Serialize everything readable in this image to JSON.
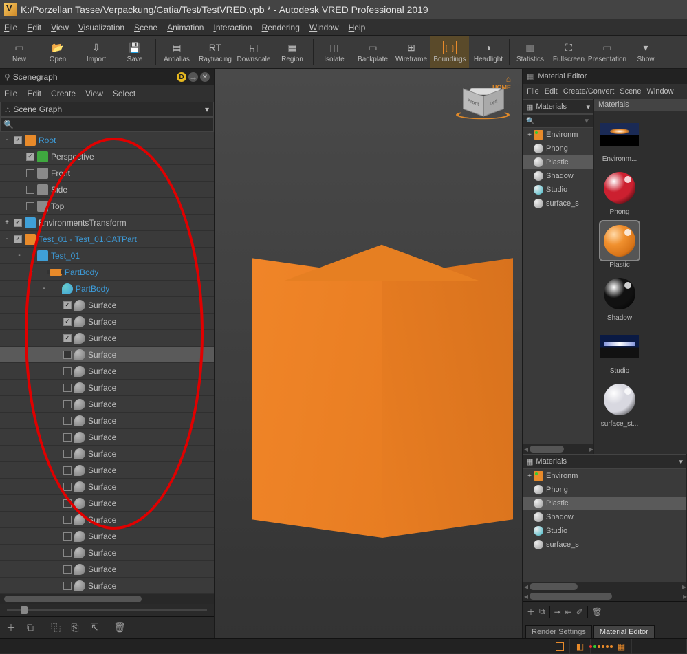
{
  "title": "K:/Porzellan Tasse/Verpackung/Catia/Test/TestVRED.vpb * - Autodesk VRED Professional 2019",
  "menu": [
    "File",
    "Edit",
    "View",
    "Visualization",
    "Scene",
    "Animation",
    "Interaction",
    "Rendering",
    "Window",
    "Help"
  ],
  "toolbar": [
    {
      "label": "New"
    },
    {
      "label": "Open"
    },
    {
      "label": "Import"
    },
    {
      "label": "Save"
    },
    {
      "label": "Antialias"
    },
    {
      "label": "Raytracing"
    },
    {
      "label": "Downscale"
    },
    {
      "label": "Region"
    },
    {
      "label": "Isolate"
    },
    {
      "label": "Backplate"
    },
    {
      "label": "Wireframe"
    },
    {
      "label": "Boundings",
      "active": true
    },
    {
      "label": "Headlight"
    },
    {
      "label": "Statistics"
    },
    {
      "label": "Fullscreen"
    },
    {
      "label": "Presentation"
    },
    {
      "label": "Show"
    }
  ],
  "scenegraph": {
    "title": "Scenegraph",
    "menu": [
      "File",
      "Edit",
      "Create",
      "View",
      "Select"
    ],
    "dropdown": "Scene Graph",
    "tree": [
      {
        "d": 0,
        "tw": "-",
        "cb": "on",
        "ic": "#e88a2a",
        "t": "Root",
        "blue": true
      },
      {
        "d": 1,
        "tw": "",
        "cb": "on",
        "ic": "#3fa83f",
        "t": "Perspective"
      },
      {
        "d": 1,
        "tw": "",
        "cb": "off",
        "ic": "#8a8a8a",
        "t": "Front"
      },
      {
        "d": 1,
        "tw": "",
        "cb": "off",
        "ic": "#8a8a8a",
        "t": "Side"
      },
      {
        "d": 1,
        "tw": "",
        "cb": "off",
        "ic": "#8a8a8a",
        "t": "Top"
      },
      {
        "d": 0,
        "tw": "+",
        "cb": "on",
        "ic": "#3fa0d8",
        "t": "EnvironmentsTransform",
        "x": true
      },
      {
        "d": 0,
        "tw": "-",
        "cb": "on",
        "ic": "#e88a2a",
        "t": "Test_01 - Test_01.CATPart",
        "blue": true
      },
      {
        "d": 1,
        "tw": "-",
        "cb": "",
        "ic": "#3fa0d8",
        "t": "Test_01",
        "blue": true
      },
      {
        "d": 2,
        "tw": "-",
        "cb": "",
        "ic": "#e88a2a",
        "t": "PartBody",
        "blue": true,
        "bar": true
      },
      {
        "d": 3,
        "tw": "-",
        "cb": "",
        "ic": "#3fa0d8",
        "t": "PartBody",
        "blue": true,
        "leaf": true
      },
      {
        "d": 4,
        "tw": "",
        "cb": "on",
        "ic": "#9a9a9a",
        "t": "Surface",
        "surf": true
      },
      {
        "d": 4,
        "tw": "",
        "cb": "on",
        "ic": "#9a9a9a",
        "t": "Surface",
        "surf": true
      },
      {
        "d": 4,
        "tw": "",
        "cb": "on",
        "ic": "#9a9a9a",
        "t": "Surface",
        "surf": true
      },
      {
        "d": 4,
        "tw": "",
        "cb": "dark",
        "ic": "#9a9a9a",
        "t": "Surface",
        "surf": true,
        "sel": true
      },
      {
        "d": 4,
        "tw": "",
        "cb": "off",
        "ic": "#9a9a9a",
        "t": "Surface",
        "surf": true
      },
      {
        "d": 4,
        "tw": "",
        "cb": "off",
        "ic": "#9a9a9a",
        "t": "Surface",
        "surf": true
      },
      {
        "d": 4,
        "tw": "",
        "cb": "off",
        "ic": "#9a9a9a",
        "t": "Surface",
        "surf": true
      },
      {
        "d": 4,
        "tw": "",
        "cb": "off",
        "ic": "#9a9a9a",
        "t": "Surface",
        "surf": true
      },
      {
        "d": 4,
        "tw": "",
        "cb": "off",
        "ic": "#9a9a9a",
        "t": "Surface",
        "surf": true
      },
      {
        "d": 4,
        "tw": "",
        "cb": "off",
        "ic": "#9a9a9a",
        "t": "Surface",
        "surf": true
      },
      {
        "d": 4,
        "tw": "",
        "cb": "off",
        "ic": "#9a9a9a",
        "t": "Surface",
        "surf": true
      },
      {
        "d": 4,
        "tw": "",
        "cb": "off",
        "ic": "#9a9a9a",
        "t": "Surface",
        "surf": true
      },
      {
        "d": 4,
        "tw": "",
        "cb": "off",
        "ic": "#9a9a9a",
        "t": "Surface",
        "surf": true
      },
      {
        "d": 4,
        "tw": "",
        "cb": "off",
        "ic": "#9a9a9a",
        "t": "Surface",
        "surf": true
      },
      {
        "d": 4,
        "tw": "",
        "cb": "off",
        "ic": "#9a9a9a",
        "t": "Surface",
        "surf": true
      },
      {
        "d": 4,
        "tw": "",
        "cb": "off",
        "ic": "#9a9a9a",
        "t": "Surface",
        "surf": true
      },
      {
        "d": 4,
        "tw": "",
        "cb": "off",
        "ic": "#9a9a9a",
        "t": "Surface",
        "surf": true
      },
      {
        "d": 4,
        "tw": "",
        "cb": "off",
        "ic": "#9a9a9a",
        "t": "Surface",
        "surf": true
      },
      {
        "d": 4,
        "tw": "",
        "cb": "off",
        "ic": "#9a9a9a",
        "t": "Surface",
        "surf": true
      },
      {
        "d": 4,
        "tw": "",
        "cb": "off",
        "ic": "#9a9a9a",
        "t": "Surface",
        "surf": true
      }
    ]
  },
  "viewcube": {
    "home": "HOME",
    "front": "Front",
    "left": "Left"
  },
  "material_editor": {
    "title": "Material Editor",
    "menu": [
      "File",
      "Edit",
      "Create/Convert",
      "Scene",
      "Window"
    ],
    "dropdown": "Materials",
    "gallery_header": "Materials",
    "tree": [
      {
        "t": "Environm",
        "ic": "#e88a2a",
        "tw": "+"
      },
      {
        "t": "Phong",
        "ball": "#999"
      },
      {
        "t": "Plastic",
        "ball": "#999",
        "sel": true
      },
      {
        "t": "Shadow",
        "ball": "#999"
      },
      {
        "t": "Studio",
        "ball": "#3bb6c6"
      },
      {
        "t": "surface_s",
        "ball": "#999"
      }
    ],
    "tree2": [
      {
        "t": "Environm",
        "ic": "#e88a2a",
        "tw": "+"
      },
      {
        "t": "Phong",
        "ball": "#999"
      },
      {
        "t": "Plastic",
        "ball": "#999",
        "sel": true
      },
      {
        "t": "Shadow",
        "ball": "#999"
      },
      {
        "t": "Studio",
        "ball": "#3bb6c6"
      },
      {
        "t": "surface_s",
        "ball": "#999"
      }
    ],
    "gallery": [
      {
        "t": "Environm...",
        "type": "env"
      },
      {
        "t": "Phong",
        "type": "sphere",
        "col": "#cc2030"
      },
      {
        "t": "Plastic",
        "type": "sphere",
        "col": "#e88a2a",
        "sel": true
      },
      {
        "t": "Shadow",
        "type": "sphere",
        "col": "#111"
      },
      {
        "t": "Studio",
        "type": "env2"
      },
      {
        "t": "surface_st...",
        "type": "sphere",
        "col": "#d8d8e0"
      }
    ],
    "tabs": [
      {
        "t": "Render Settings"
      },
      {
        "t": "Material Editor",
        "active": true
      }
    ]
  }
}
